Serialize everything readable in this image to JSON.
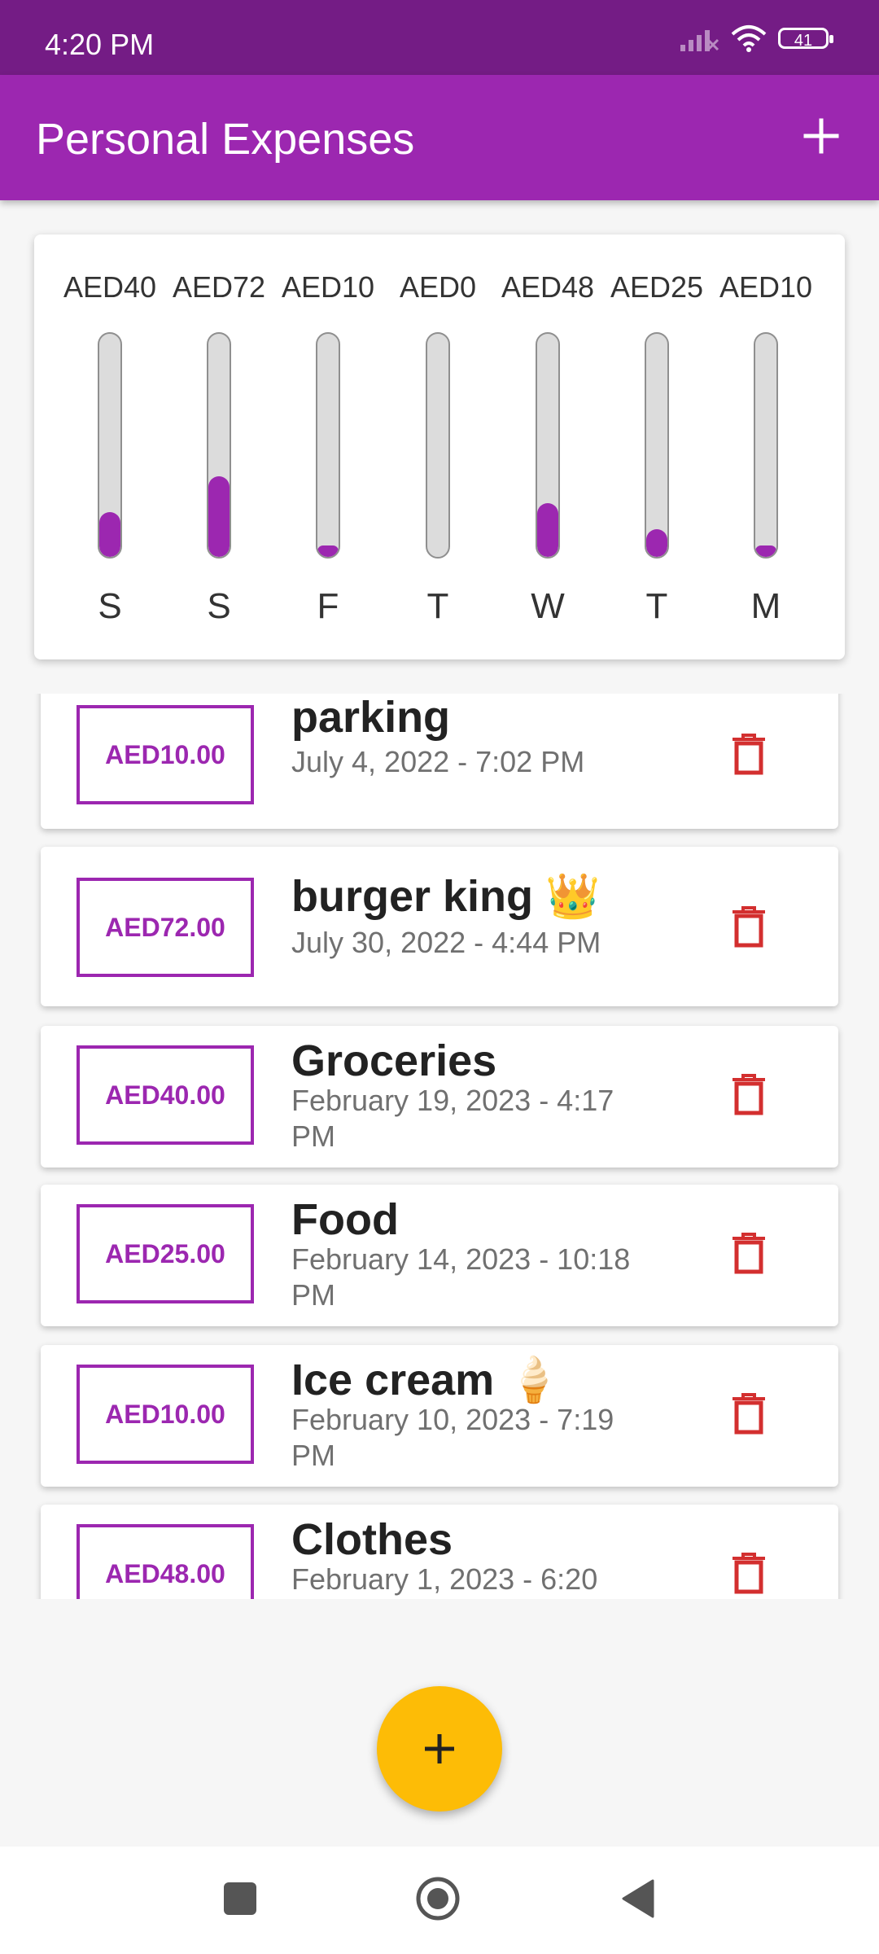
{
  "status_bar": {
    "time": "4:20 PM",
    "battery": "41"
  },
  "app_bar": {
    "title": "Personal Expenses"
  },
  "chart": {
    "bars": [
      {
        "day": "S",
        "amount": "AED40",
        "fraction": 0.2
      },
      {
        "day": "S",
        "amount": "AED72",
        "fraction": 0.36
      },
      {
        "day": "F",
        "amount": "AED10",
        "fraction": 0.05
      },
      {
        "day": "T",
        "amount": "AED0",
        "fraction": 0
      },
      {
        "day": "W",
        "amount": "AED48",
        "fraction": 0.24
      },
      {
        "day": "T",
        "amount": "AED25",
        "fraction": 0.125
      },
      {
        "day": "M",
        "amount": "AED10",
        "fraction": 0.05
      }
    ]
  },
  "transactions": [
    {
      "amount": "AED10.00",
      "title": "parking",
      "date": "July 4, 2022 - 7:02 PM"
    },
    {
      "amount": "AED72.00",
      "title": "burger king 👑",
      "date": "July 30, 2022 - 4:44 PM"
    },
    {
      "amount": "AED40.00",
      "title": "Groceries",
      "date": "February 19, 2023 - 4:17 PM"
    },
    {
      "amount": "AED25.00",
      "title": "Food",
      "date": "February 14, 2023 - 10:18 PM"
    },
    {
      "amount": "AED10.00",
      "title": "Ice cream 🍦",
      "date": "February 10, 2023 - 7:19 PM"
    },
    {
      "amount": "AED48.00",
      "title": "Clothes",
      "date": "February 1, 2023 - 6:20"
    }
  ],
  "colors": {
    "primary": "#9c27b0",
    "primary_dark": "#741c85",
    "fab": "#fdbc06",
    "delete": "#d32f2f"
  },
  "icons": {
    "app_add": "plus-icon",
    "fab": "plus-icon",
    "delete": "trash-icon"
  }
}
